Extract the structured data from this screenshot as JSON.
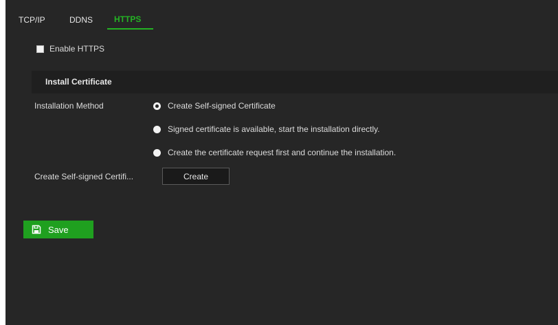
{
  "tabs": [
    {
      "label": "TCP/IP",
      "active": false
    },
    {
      "label": "DDNS",
      "active": false
    },
    {
      "label": "HTTPS",
      "active": true
    }
  ],
  "enable_https": {
    "label": "Enable HTTPS",
    "checked": false
  },
  "install_certificate": {
    "title": "Install Certificate",
    "method_label": "Installation Method",
    "options": [
      {
        "label": "Create Self-signed Certificate",
        "selected": true
      },
      {
        "label": "Signed certificate is available, start the installation directly.",
        "selected": false
      },
      {
        "label": "Create the certificate request first and continue the installation.",
        "selected": false
      }
    ],
    "create_label": "Create Self-signed Certifi...",
    "create_button": "Create"
  },
  "save_button": {
    "label": "Save",
    "icon": "save-icon"
  },
  "colors": {
    "background": "#262626",
    "accent": "#24b324",
    "save_button": "#1fa01f",
    "section_header": "#1f1f1f"
  }
}
